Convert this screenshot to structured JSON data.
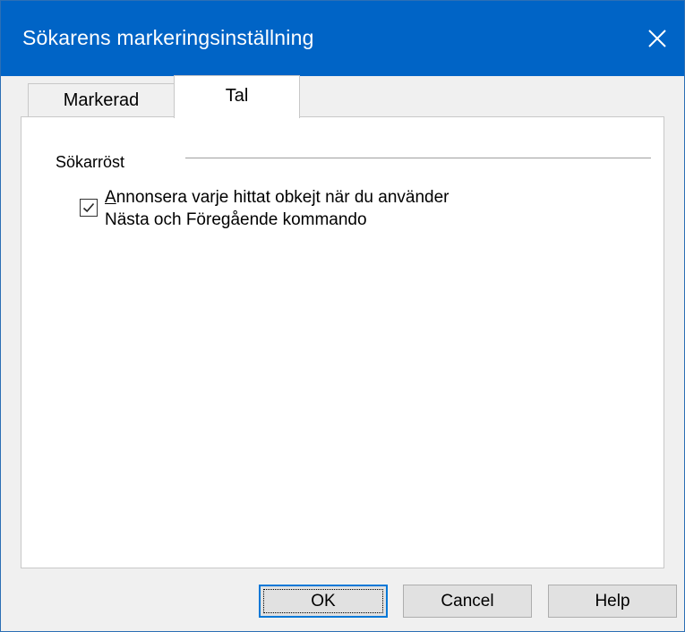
{
  "window": {
    "title": "Sökarens markeringsinställning"
  },
  "tabs": [
    {
      "label": "Markerad",
      "selected": false
    },
    {
      "label": "Tal",
      "selected": true
    }
  ],
  "panel": {
    "group_label": "Sökarröst",
    "checkbox": {
      "checked": true,
      "label_line1": "Annonsera varje hittat obkejt när du använder",
      "label_line2": "Nästa och Föregående kommando"
    }
  },
  "buttons": {
    "ok": "OK",
    "cancel": "Cancel",
    "help": "Help"
  },
  "colors": {
    "titlebar": "#0064c6",
    "focus_border": "#0078d7"
  },
  "icons": {
    "close": "close-icon",
    "check": "checkmark-icon"
  }
}
